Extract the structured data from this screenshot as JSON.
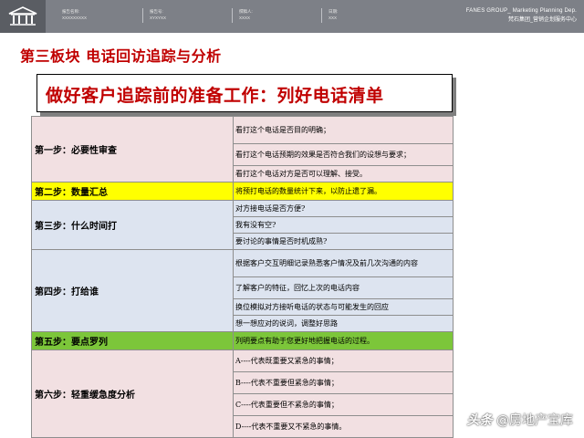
{
  "header": {
    "meta": [
      {
        "label": "报告名称:",
        "value": "XXXXXXXXX"
      },
      {
        "label": "报告号:",
        "value": "XYXYXX"
      },
      {
        "label": "撰稿人:",
        "value": "XXXX"
      },
      {
        "label": "日期:",
        "value": "XXX"
      }
    ],
    "brand_en": "FANES GROUP_ Marketing Planning Dep.",
    "brand_cn": "梵石集团_营销企划服务中心"
  },
  "section_title": "第三板块 电话回访追踪与分析",
  "callout_title": "做好客户追踪前的准备工作：列好电话清单",
  "table": {
    "rows": [
      {
        "step": "第一步：必要性审查",
        "items": [
          "看打这个电话是否目的明确；",
          "看打这个电话预期的效果是否符合我们的设想与要求；",
          "看打这个电话对方是否可以理解、接受。"
        ]
      },
      {
        "step": "第二步：数量汇总",
        "items": [
          "将预打电话的数量统计下来，以防止遗了漏。"
        ]
      },
      {
        "step": "第三步：什么时间打",
        "items": [
          "对方接电话是否方便?",
          "我有没有空?",
          "要讨论的事情是否时机成熟?"
        ]
      },
      {
        "step": "第四步：打给谁",
        "items": [
          "根据客户交互明细记录熟悉客户情况及前几次沟通的内容",
          "了解客户的特征，回忆上次的电话内容",
          "换位模拟对方接听电话的状态与可能发生的回应",
          "想一想应对的说词，调整好思路"
        ]
      },
      {
        "step": "第五步：要点罗列",
        "items": [
          "列明要点有助于您更好地把握电话的过程。"
        ]
      },
      {
        "step": "第六步：轻重缓急度分析",
        "items": [
          "A----代表既重要又紧急的事情；",
          "B----代表不重要但紧急的事情；",
          "C----代表重要但不紧急的事情；",
          "D----代表不重要又不紧急的事情。"
        ]
      }
    ]
  },
  "watermark": {
    "logo": "头条",
    "text": "@房地产宝库"
  },
  "colors": {
    "header_bg": "#7d8087",
    "title_red": "#c00000",
    "row_pink": "#f2e0e2",
    "row_yellow": "#ffff00",
    "row_blue": "#dde4f0",
    "row_green": "#7cc63a"
  }
}
